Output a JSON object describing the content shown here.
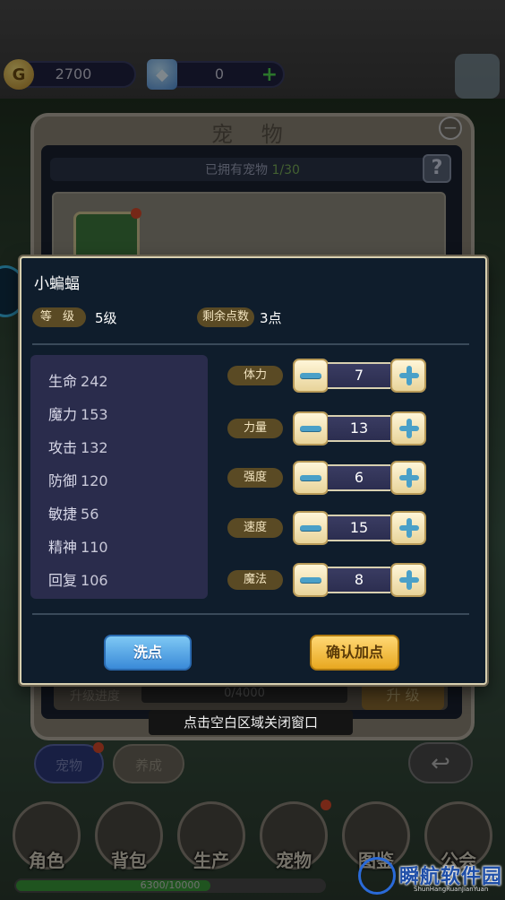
{
  "resources": {
    "gold": "2700",
    "gold_icon": "gold-coin-icon",
    "gems": "0",
    "gems_icon": "diamond-icon",
    "plus": "+"
  },
  "pet_panel": {
    "title": "宠 物",
    "owned_label": "已拥有宠物",
    "owned_count": "1/30",
    "help": "?",
    "close": "−",
    "upgrade_label": "升级进度",
    "upgrade_progress": "0/4000",
    "upgrade_button": "升 级",
    "close_hint": "点击空白区域关闭窗口"
  },
  "tabs": {
    "pet": "宠物",
    "train": "养成",
    "back": "↩"
  },
  "nav": {
    "items": [
      "角色",
      "背包",
      "生产",
      "宠物",
      "图鉴",
      "公会"
    ]
  },
  "exp_bar": {
    "text": "6300/10000",
    "fill": 0.63
  },
  "watermark": {
    "title": "瞬航软件园",
    "sub": "ShunHangRuanJianYuan"
  },
  "modal": {
    "pet_name": "小蝙蝠",
    "level_label": "等 级",
    "level_value": "5级",
    "points_label": "剩余点数",
    "points_value": "3点",
    "stats": [
      {
        "name": "生命",
        "value": "242"
      },
      {
        "name": "魔力",
        "value": "153"
      },
      {
        "name": "攻击",
        "value": "132"
      },
      {
        "name": "防御",
        "value": "120"
      },
      {
        "name": "敏捷",
        "value": "56"
      },
      {
        "name": "精神",
        "value": "110"
      },
      {
        "name": "回复",
        "value": "106"
      }
    ],
    "attributes": [
      {
        "label": "体力",
        "value": "7"
      },
      {
        "label": "力量",
        "value": "13"
      },
      {
        "label": "强度",
        "value": "6"
      },
      {
        "label": "速度",
        "value": "15"
      },
      {
        "label": "魔法",
        "value": "8"
      }
    ],
    "reset_button": "洗点",
    "confirm_button": "确认加点"
  },
  "colors": {
    "modal_bg": "#0f1d2c",
    "chip": "#5a4a24",
    "stats_bg": "#2a2c4c",
    "confirm": "#e8a820",
    "reset": "#3a8ad8"
  }
}
